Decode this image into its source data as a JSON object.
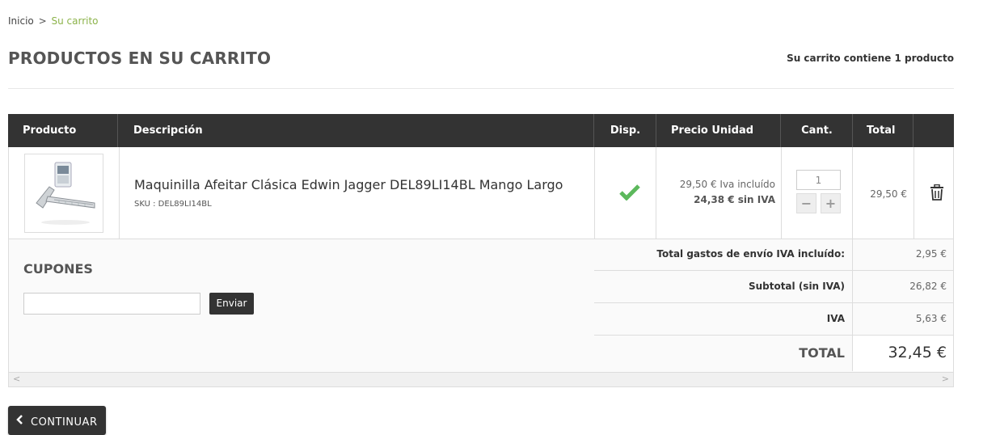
{
  "breadcrumb": {
    "home": "Inicio",
    "separator": ">",
    "current": "Su carrito"
  },
  "header": {
    "title": "PRODUCTOS EN SU CARRITO",
    "cart_count": "Su carrito contiene 1 producto"
  },
  "table": {
    "columns": [
      "Producto",
      "Descripción",
      "Disp.",
      "Precio Unidad",
      "Cant.",
      "Total"
    ],
    "rows": [
      {
        "name": "Maquinilla Afeitar Clásica Edwin Jagger DEL89LI14BL Mango Largo",
        "sku": "SKU : DEL89LI14BL",
        "available_icon": "check-icon",
        "price_inc": "29,50 € Iva incluído",
        "price_ex": "24,38 € sin IVA",
        "quantity": "1",
        "total": "29,50 €"
      }
    ]
  },
  "coupons": {
    "title": "CUPONES",
    "input_value": "",
    "submit_label": "Enviar"
  },
  "totals": {
    "shipping_label": "Total gastos de envío IVA incluído:",
    "shipping_value": "2,95 €",
    "subtotal_label": "Subtotal (sin IVA)",
    "subtotal_value": "26,82 €",
    "tax_label": "IVA",
    "tax_value": "5,63 €",
    "grand_label": "TOTAL",
    "grand_value": "32,45 €"
  },
  "actions": {
    "continue_label": "CONTINUAR"
  },
  "colors": {
    "accent": "#8cb34a",
    "header_bg": "#333333",
    "check": "#5cb85c"
  }
}
